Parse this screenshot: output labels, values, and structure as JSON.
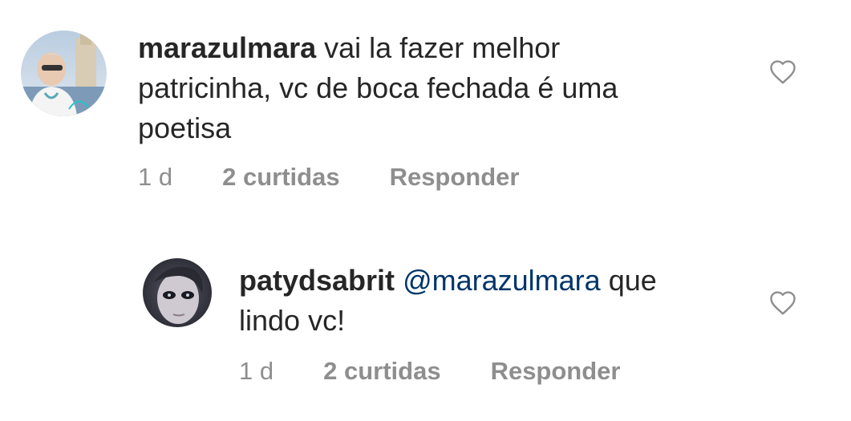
{
  "comments": [
    {
      "username": "marazulmara",
      "text": "vai la fazer melhor",
      "text_line2": "patricinha, vc de boca fechada é uma",
      "text_line3": "poetisa",
      "time": "1 d",
      "likes": "2 curtidas",
      "reply_label": "Responder",
      "like_icon": "heart-outline-icon"
    },
    {
      "username": "patydsabrit",
      "mention": "@marazulmara",
      "text": "que",
      "text_line2": "lindo vc!",
      "time": "1 d",
      "likes": "2 curtidas",
      "reply_label": "Responder",
      "like_icon": "heart-outline-icon"
    }
  ],
  "colors": {
    "text": "#262626",
    "meta": "#8e8e8e",
    "mention": "#003569",
    "icon": "#8e8e8e"
  }
}
